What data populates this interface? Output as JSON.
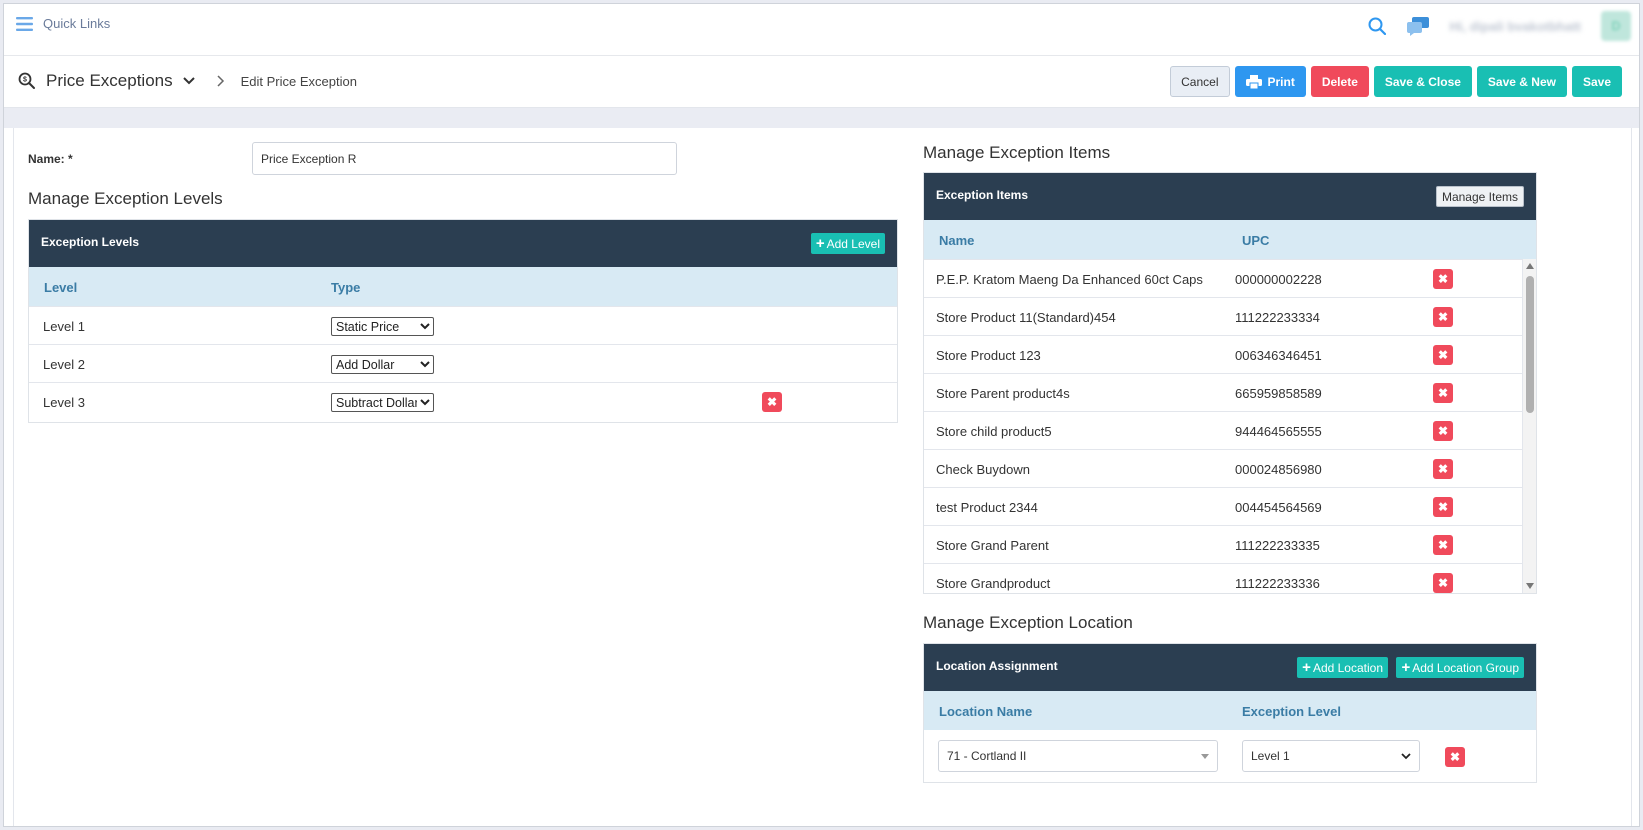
{
  "topbar": {
    "quick_links": "Quick Links",
    "user_name": "Hi, dipali bvakotbhatt",
    "avatar_initial": "D"
  },
  "header": {
    "page_title": "Price Exceptions",
    "sub_title": "Edit Price Exception",
    "buttons": {
      "cancel": "Cancel",
      "print": "Print",
      "delete": "Delete",
      "save_close": "Save & Close",
      "save_new": "Save & New",
      "save": "Save"
    }
  },
  "form": {
    "name_label": "Name: *",
    "name_value": "Price Exception R"
  },
  "levels": {
    "section_title": "Manage Exception Levels",
    "panel_title": "Exception Levels",
    "add_label": "Add Level",
    "col_level": "Level",
    "col_type": "Type",
    "type_options": [
      "Static Price",
      "Add Dollar",
      "Subtract Dollar"
    ],
    "rows": [
      {
        "level": "Level 1",
        "type": "Static Price"
      },
      {
        "level": "Level 2",
        "type": "Add Dollar"
      },
      {
        "level": "Level 3",
        "type": "Subtract Dollar"
      }
    ]
  },
  "items": {
    "section_title": "Manage Exception Items",
    "panel_title": "Exception Items",
    "manage_label": "Manage Items",
    "col_name": "Name",
    "col_upc": "UPC",
    "rows": [
      {
        "name": "P.E.P. Kratom Maeng Da Enhanced 60ct Caps",
        "upc": "000000002228"
      },
      {
        "name": "Store Product 11(Standard)454",
        "upc": "111222233334"
      },
      {
        "name": "Store Product 123",
        "upc": "006346346451"
      },
      {
        "name": "Store Parent product4s",
        "upc": "665959858589"
      },
      {
        "name": "Store child product5",
        "upc": "944464565555"
      },
      {
        "name": "Check Buydown",
        "upc": "000024856980"
      },
      {
        "name": "test Product 2344",
        "upc": "004454564569"
      },
      {
        "name": "Store Grand Parent",
        "upc": "111222233335"
      },
      {
        "name": "Store Grandproduct",
        "upc": "111222233336"
      }
    ]
  },
  "location": {
    "section_title": "Manage Exception Location",
    "panel_title": "Location Assignment",
    "add_location": "Add Location",
    "add_group": "Add Location Group",
    "col_location": "Location Name",
    "col_level": "Exception Level",
    "rows": [
      {
        "location": "71 - Cortland II",
        "level": "Level 1"
      }
    ]
  },
  "colors": {
    "navy": "#2b3e51",
    "teal": "#19bfb3",
    "blue": "#2e97f0",
    "red": "#f04a5b",
    "header_bg": "#d8eaf4"
  }
}
